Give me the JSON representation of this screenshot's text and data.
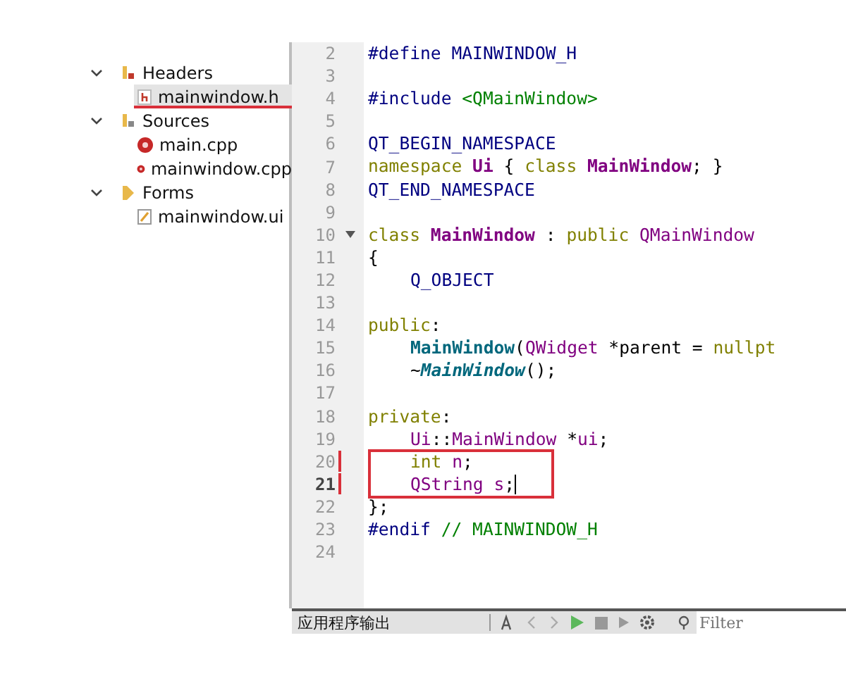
{
  "project_tree": [
    {
      "label": "Headers",
      "kind": "header_folder",
      "expanded": true,
      "selected": false,
      "underlined": false,
      "children": [
        {
          "label": "mainwindow.h",
          "kind": "header_file",
          "selected": true,
          "underlined": true
        }
      ]
    },
    {
      "label": "Sources",
      "kind": "source_folder",
      "expanded": true,
      "selected": false,
      "underlined": false,
      "children": [
        {
          "label": "main.cpp",
          "kind": "source_file",
          "selected": false,
          "underlined": false
        },
        {
          "label": "mainwindow.cpp",
          "kind": "source_file",
          "selected": false,
          "underlined": false
        }
      ]
    },
    {
      "label": "Forms",
      "kind": "form_folder",
      "expanded": true,
      "selected": false,
      "underlined": false,
      "children": [
        {
          "label": "mainwindow.ui",
          "kind": "form_file",
          "selected": false,
          "underlined": false
        }
      ]
    }
  ],
  "editor": {
    "lines": [
      {
        "number": "2",
        "indented": false,
        "foldable": false,
        "modified": false,
        "current": false,
        "boxed": false,
        "tokens": [
          {
            "text": "#define ",
            "kind": "directive"
          },
          {
            "text": "MAINWINDOW_H",
            "kind": "macro"
          }
        ]
      },
      {
        "number": "3",
        "foldable": false,
        "modified": false,
        "current": false,
        "boxed": false
      },
      {
        "number": "4",
        "indented": false,
        "foldable": false,
        "modified": false,
        "current": false,
        "boxed": false,
        "tokens": [
          {
            "text": "#include ",
            "kind": "directive"
          },
          {
            "text": "<QMainWindow>",
            "kind": "string"
          }
        ]
      },
      {
        "number": "5",
        "foldable": false,
        "modified": false,
        "current": false,
        "boxed": false
      },
      {
        "number": "6",
        "indented": false,
        "foldable": false,
        "modified": false,
        "current": false,
        "boxed": false,
        "tokens": [
          {
            "text": "QT_BEGIN_NAMESPACE",
            "kind": "macro"
          }
        ]
      },
      {
        "number": "7",
        "indented": false,
        "foldable": false,
        "modified": false,
        "current": false,
        "boxed": false,
        "tokens": [
          {
            "text": "namespace ",
            "kind": "keyword"
          },
          {
            "text": "Ui",
            "kind": "class"
          },
          {
            "text": " { ",
            "kind": "plain"
          },
          {
            "text": "class ",
            "kind": "keyword"
          },
          {
            "text": "MainWindow",
            "kind": "class"
          },
          {
            "text": "; }",
            "kind": "plain"
          }
        ]
      },
      {
        "number": "8",
        "indented": false,
        "foldable": false,
        "modified": false,
        "current": false,
        "boxed": false,
        "tokens": [
          {
            "text": "QT_END_NAMESPACE",
            "kind": "macro"
          }
        ]
      },
      {
        "number": "9",
        "foldable": false,
        "modified": false,
        "current": false,
        "boxed": false
      },
      {
        "number": "10",
        "indented": false,
        "foldable": true,
        "modified": false,
        "current": false,
        "boxed": false,
        "tokens": [
          {
            "text": "class ",
            "kind": "keyword"
          },
          {
            "text": "MainWindow",
            "kind": "class"
          },
          {
            "text": " : ",
            "kind": "plain"
          },
          {
            "text": "public ",
            "kind": "keyword"
          },
          {
            "text": "QMainWindow",
            "kind": "type"
          }
        ]
      },
      {
        "number": "11",
        "indented": false,
        "foldable": false,
        "modified": false,
        "current": false,
        "boxed": false,
        "tokens": [
          {
            "text": "{",
            "kind": "plain"
          }
        ]
      },
      {
        "number": "12",
        "indented": true,
        "foldable": false,
        "modified": false,
        "current": false,
        "boxed": false,
        "tokens": [
          {
            "text": "Q_OBJECT",
            "kind": "macro"
          }
        ]
      },
      {
        "number": "13",
        "foldable": false,
        "modified": false,
        "current": false,
        "boxed": false
      },
      {
        "number": "14",
        "indented": false,
        "foldable": false,
        "modified": false,
        "current": false,
        "boxed": false,
        "tokens": [
          {
            "text": "public",
            "kind": "keyword"
          },
          {
            "text": ":",
            "kind": "plain"
          }
        ]
      },
      {
        "number": "15",
        "indented": true,
        "foldable": false,
        "modified": false,
        "current": false,
        "boxed": false,
        "tokens": [
          {
            "text": "MainWindow",
            "kind": "function"
          },
          {
            "text": "(",
            "kind": "plain"
          },
          {
            "text": "QWidget",
            "kind": "type"
          },
          {
            "text": " *parent = ",
            "kind": "plain"
          },
          {
            "text": "nullpt",
            "kind": "keyword"
          }
        ]
      },
      {
        "number": "16",
        "indented": true,
        "foldable": false,
        "modified": false,
        "current": false,
        "boxed": false,
        "tokens": [
          {
            "text": "~",
            "kind": "plain"
          },
          {
            "text": "MainWindow",
            "kind": "virtual_function"
          },
          {
            "text": "();",
            "kind": "plain"
          }
        ]
      },
      {
        "number": "17",
        "foldable": false,
        "modified": false,
        "current": false,
        "boxed": false
      },
      {
        "number": "18",
        "indented": false,
        "foldable": false,
        "modified": false,
        "current": false,
        "boxed": false,
        "tokens": [
          {
            "text": "private",
            "kind": "keyword"
          },
          {
            "text": ":",
            "kind": "plain"
          }
        ]
      },
      {
        "number": "19",
        "indented": true,
        "foldable": false,
        "modified": false,
        "current": false,
        "boxed": false,
        "tokens": [
          {
            "text": "Ui",
            "kind": "type"
          },
          {
            "text": "::",
            "kind": "plain"
          },
          {
            "text": "MainWindow",
            "kind": "type"
          },
          {
            "text": " *",
            "kind": "plain"
          },
          {
            "text": "ui",
            "kind": "member"
          },
          {
            "text": ";",
            "kind": "plain"
          }
        ]
      },
      {
        "number": "20",
        "indented": true,
        "foldable": false,
        "modified": true,
        "current": false,
        "boxed": true,
        "tokens": [
          {
            "text": "int ",
            "kind": "keyword"
          },
          {
            "text": "n",
            "kind": "member"
          },
          {
            "text": ";",
            "kind": "plain"
          }
        ]
      },
      {
        "number": "21",
        "indented": true,
        "foldable": false,
        "modified": true,
        "current": true,
        "boxed": true,
        "tokens": [
          {
            "text": "QString",
            "kind": "type"
          },
          {
            "text": " s",
            "kind": "member"
          },
          {
            "text": ";",
            "kind": "plain"
          }
        ]
      },
      {
        "number": "22",
        "indented": false,
        "foldable": false,
        "modified": false,
        "current": false,
        "boxed": false,
        "tokens": [
          {
            "text": "};",
            "kind": "plain"
          }
        ]
      },
      {
        "number": "23",
        "indented": false,
        "foldable": false,
        "modified": false,
        "current": false,
        "boxed": false,
        "tokens": [
          {
            "text": "#endif ",
            "kind": "directive"
          },
          {
            "text": "// MAINWINDOW_H",
            "kind": "comment"
          }
        ]
      },
      {
        "number": "24",
        "foldable": false,
        "modified": false,
        "current": false,
        "boxed": false
      }
    ]
  },
  "output_pane": {
    "title": "应用程序输出",
    "filter": {
      "placeholder": "Filter"
    }
  }
}
